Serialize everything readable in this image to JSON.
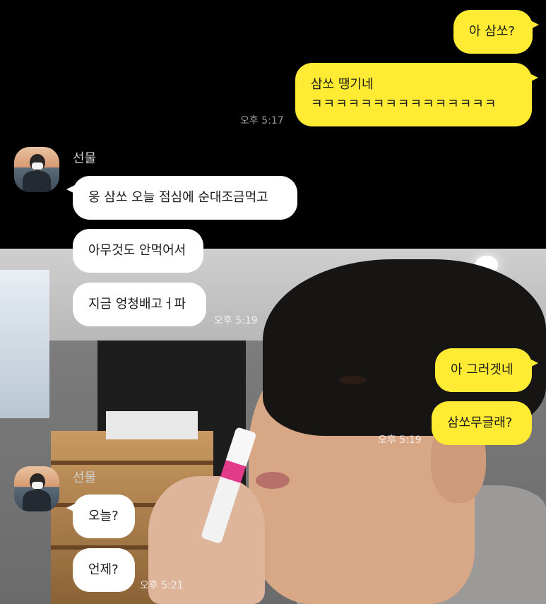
{
  "chat": {
    "messages_top": {
      "m1": "아 삼쏘?",
      "m2_line1": "삼쏘 땡기네",
      "m2_line2": "ㅋㅋㅋㅋㅋㅋㅋㅋㅋㅋㅋㅋㅋㅋㅋ",
      "time1": "오후 5:17"
    },
    "group1": {
      "sender": "선물",
      "msg1": "웅 삼쏘 오늘 점심에 순대조금먹고",
      "msg2": "아무것도 안먹어서",
      "msg3": "지금 엉청배고ㅓ파",
      "time": "오후 5:19"
    },
    "mine2": {
      "msg1": "아 그러겟네",
      "msg2": "삼쏘무글래?",
      "time": "오후 5:19"
    },
    "group2": {
      "sender": "선물",
      "msg1": "오늘?",
      "msg2": "언제?",
      "time": "오후 5:21"
    }
  },
  "colors": {
    "my_bubble": "#FFEB33",
    "their_bubble": "#FFFFFF",
    "chat_bg": "#000000"
  }
}
